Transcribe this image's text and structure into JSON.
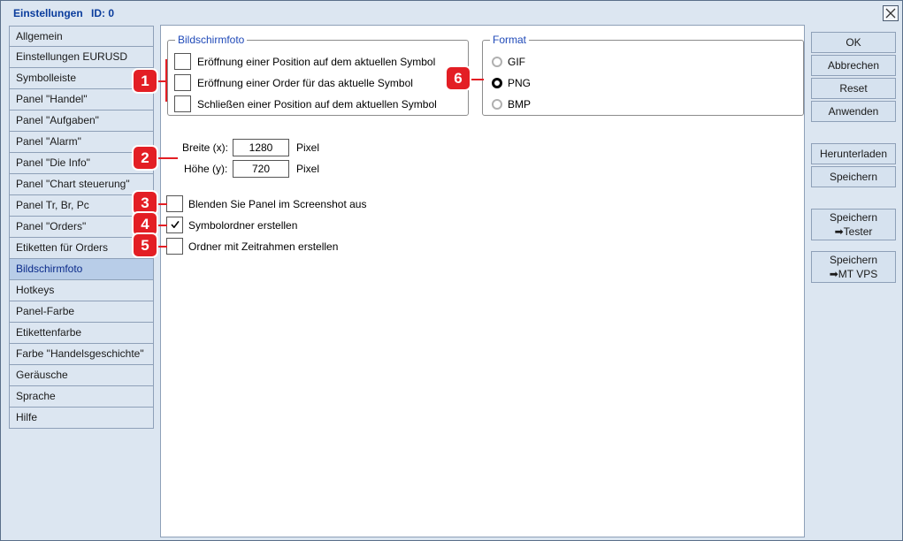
{
  "window": {
    "title": "Einstellungen",
    "id_label": "ID: 0"
  },
  "sidebar": {
    "items": [
      {
        "label": "Allgemein"
      },
      {
        "label": "Einstellungen EURUSD"
      },
      {
        "label": "Symbolleiste"
      },
      {
        "label": "Panel \"Handel\""
      },
      {
        "label": "Panel \"Aufgaben\""
      },
      {
        "label": "Panel \"Alarm\""
      },
      {
        "label": "Panel \"Die Info\""
      },
      {
        "label": "Panel \"Chart steuerung\""
      },
      {
        "label": "Panel Tr, Br, Pc"
      },
      {
        "label": "Panel \"Orders\""
      },
      {
        "label": "Etiketten für Orders"
      },
      {
        "label": "Bildschirmfoto"
      },
      {
        "label": "Hotkeys"
      },
      {
        "label": "Panel-Farbe"
      },
      {
        "label": "Etikettenfarbe"
      },
      {
        "label": "Farbe \"Handelsgeschichte\""
      },
      {
        "label": "Geräusche"
      },
      {
        "label": "Sprache"
      },
      {
        "label": "Hilfe"
      }
    ],
    "active": "Bildschirmfoto"
  },
  "screenshot_group": {
    "title": "Bildschirmfoto",
    "options": [
      {
        "label": "Eröffnung einer Position auf dem aktuellen Symbol",
        "checked": false
      },
      {
        "label": "Eröffnung einer Order für das aktuelle Symbol",
        "checked": false
      },
      {
        "label": "Schließen einer Position auf dem aktuellen Symbol",
        "checked": false
      }
    ]
  },
  "format_group": {
    "title": "Format",
    "options": [
      {
        "label": "GIF",
        "selected": false
      },
      {
        "label": "PNG",
        "selected": true
      },
      {
        "label": "BMP",
        "selected": false
      }
    ]
  },
  "size": {
    "width_label": "Breite (x):",
    "width_value": "1280",
    "height_label": "Höhe (y):",
    "height_value": "720",
    "unit": "Pixel"
  },
  "extra_options": [
    {
      "label": "Blenden Sie Panel im Screenshot aus",
      "checked": false
    },
    {
      "label": "Symbolordner erstellen",
      "checked": true
    },
    {
      "label": "Ordner mit Zeitrahmen erstellen",
      "checked": false
    }
  ],
  "buttons": {
    "ok": "OK",
    "cancel": "Abbrechen",
    "reset": "Reset",
    "apply": "Anwenden",
    "download": "Herunterladen",
    "save": "Speichern",
    "save_tester_top": "Speichern",
    "save_tester_bottom": "➡Tester",
    "save_vps_top": "Speichern",
    "save_vps_bottom": "➡MT VPS"
  },
  "markers": [
    "1",
    "2",
    "3",
    "4",
    "5",
    "6"
  ],
  "colors": {
    "accent": "#0a3c9c",
    "marker": "#e31e24",
    "window_bg": "#dce6f1",
    "active_item": "#b8cde8"
  }
}
